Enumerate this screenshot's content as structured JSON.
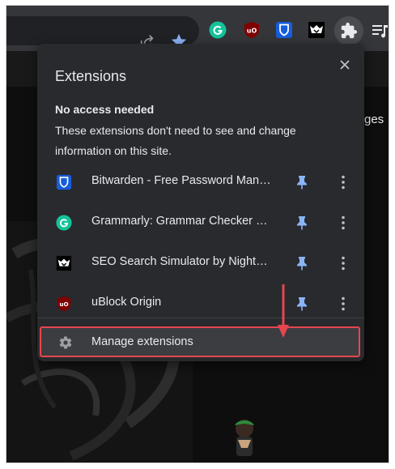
{
  "toolbar": {
    "icons": [
      "share-icon",
      "star-icon",
      "grammarly-icon",
      "ublock-icon",
      "bitwarden-icon",
      "seo-simulator-icon",
      "puzzle-icon",
      "playlist-icon"
    ]
  },
  "page": {
    "side_text": "ges"
  },
  "popup": {
    "title": "Extensions",
    "section_heading": "No access needed",
    "section_description": "These extensions don't need to see and change information on this site.",
    "extensions": [
      {
        "name": "Bitwarden - Free Password Manager",
        "icon": "bitwarden-icon"
      },
      {
        "name": "Grammarly: Grammar Checker and Writing App",
        "icon": "grammarly-icon"
      },
      {
        "name": "SEO Search Simulator by Nightwatch",
        "icon": "seo-simulator-icon"
      },
      {
        "name": "uBlock Origin",
        "icon": "ublock-icon"
      }
    ],
    "manage_label": "Manage extensions"
  },
  "colors": {
    "popup_bg": "#292a2d",
    "pin_blue": "#8ab4f8",
    "highlight_red": "#e5464f",
    "star_blue": "#8ab4f8"
  }
}
